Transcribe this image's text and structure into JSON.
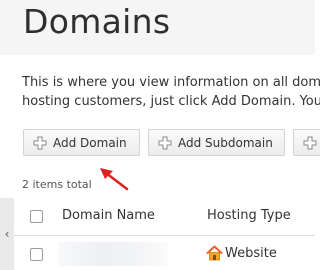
{
  "header": {
    "title": "Domains"
  },
  "description": {
    "line1": "This is where you view information on all dom",
    "line2": "hosting customers, just click Add Domain. You"
  },
  "toolbar": {
    "add_domain_label": "Add Domain",
    "add_subdomain_label": "Add Subdomain",
    "more_label": ""
  },
  "list": {
    "items_count": "2 items total",
    "columns": {
      "domain_name": "Domain Name",
      "hosting_type": "Hosting Type"
    },
    "rows": [
      {
        "domain": "",
        "hosting_type": "Website",
        "hosting_icon": "house-icon"
      }
    ]
  },
  "colors": {
    "arrow": "#e02020",
    "plus_icon": "#8a8a8a",
    "house_roof": "#e8632a",
    "house_body": "#f5a623"
  }
}
